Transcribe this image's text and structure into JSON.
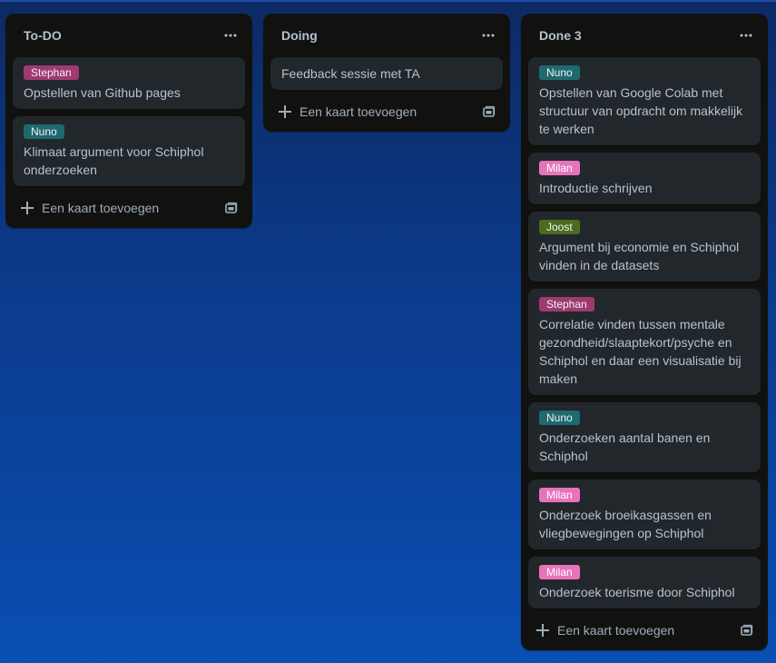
{
  "colors": {
    "board_bg": "#0b3b8c",
    "list_bg": "#111210",
    "card_bg": "#22272b",
    "text": "#b6c2cf"
  },
  "add_card_label": "Een kaart toevoegen",
  "lists": [
    {
      "title": "To-DO",
      "cards": [
        {
          "label": "Stephan",
          "label_color": "#9e3a70",
          "title": "Opstellen van Github pages"
        },
        {
          "label": "Nuno",
          "label_color": "#1f6a6f",
          "title": "Klimaat argument voor Schiphol onderzoeken"
        }
      ]
    },
    {
      "title": "Doing",
      "cards": [
        {
          "title": "Feedback sessie met TA"
        }
      ]
    },
    {
      "title": "Done 3",
      "cards": [
        {
          "label": "Nuno",
          "label_color": "#1f6a6f",
          "title": "Opstellen van Google Colab met structuur van opdracht om makkelijk te werken"
        },
        {
          "label": "Milan",
          "label_color": "#e774bb",
          "title": "Introductie schrijven"
        },
        {
          "label": "Joost",
          "label_color": "#4c6b1f",
          "title": "Argument bij economie en Schiphol vinden in de datasets"
        },
        {
          "label": "Stephan",
          "label_color": "#9e3a70",
          "title": "Correlatie vinden tussen mentale gezondheid/slaaptekort/psyche en Schiphol en daar een visualisatie bij maken"
        },
        {
          "label": "Nuno",
          "label_color": "#1f6a6f",
          "title": "Onderzoeken aantal banen en Schiphol"
        },
        {
          "label": "Milan",
          "label_color": "#e774bb",
          "title": "Onderzoek broeikasgassen en vliegbewegingen op Schiphol"
        },
        {
          "label": "Milan",
          "label_color": "#e774bb",
          "title": "Onderzoek toerisme door Schiphol"
        }
      ]
    }
  ]
}
